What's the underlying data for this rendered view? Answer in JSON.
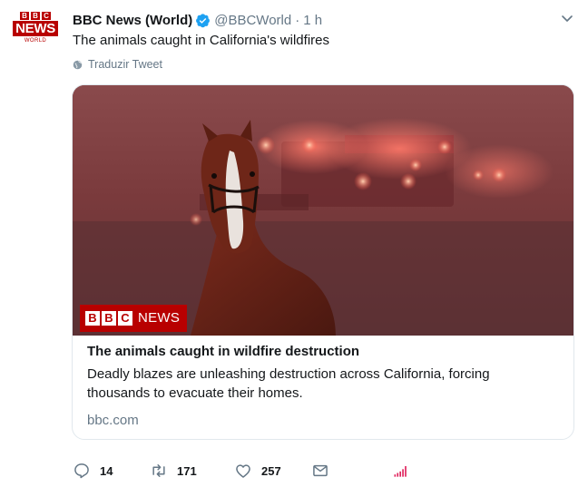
{
  "tweet": {
    "avatar": {
      "bbc_letters": [
        "B",
        "B",
        "C"
      ],
      "news": "NEWS",
      "world": "WORLD"
    },
    "author_name": "BBC News (World)",
    "handle": "@BBCWorld",
    "separator": "·",
    "time": "1 h",
    "text": "The animals caught in California's wildfires",
    "translate_label": "Traduzir Tweet",
    "card": {
      "image_logo": {
        "bbc_letters": [
          "B",
          "B",
          "C"
        ],
        "news": "NEWS"
      },
      "title": "The animals caught in wildfire destruction",
      "description": "Deadly blazes are unleashing destruction across California, forcing thousands to evacuate their homes.",
      "domain": "bbc.com"
    },
    "actions": {
      "reply_count": "14",
      "retweet_count": "171",
      "like_count": "257"
    }
  },
  "colors": {
    "brand_red": "#b80000",
    "verified_blue": "#1da1f2",
    "secondary_text": "#657786",
    "analytics_red": "#e0245e"
  },
  "icons": [
    "verified-badge-icon",
    "chevron-down-icon",
    "globe-icon",
    "reply-icon",
    "retweet-icon",
    "like-icon",
    "dm-icon",
    "analytics-icon"
  ]
}
